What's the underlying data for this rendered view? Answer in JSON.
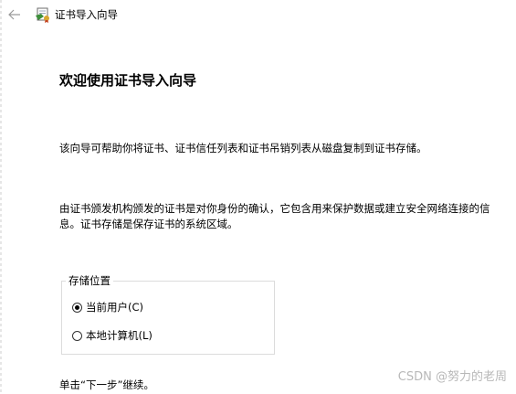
{
  "window": {
    "title": "证书导入向导"
  },
  "icons": {
    "back": "arrow-left-icon",
    "app": "certificate-icon"
  },
  "colors": {
    "background": "#ffffff",
    "text": "#000000",
    "group_border": "#dcdcdc",
    "watermark": "#b8b8b8"
  },
  "main": {
    "heading": "欢迎使用证书导入向导",
    "intro": "该向导可帮助你将证书、证书信任列表和证书吊销列表从磁盘复制到证书存储。",
    "description_lines": [
      "由证书颁发机构颁发的证书是对你身份的确认，它包含用来保护数据或建立安全网络连接的信",
      "息。证书存储是保存证书的系统区域。"
    ]
  },
  "store_location": {
    "legend": "存储位置",
    "options": [
      {
        "label": "当前用户(C)",
        "checked": true
      },
      {
        "label": "本地计算机(L)",
        "checked": false
      }
    ]
  },
  "footer": {
    "instruction": "单击“下一步”继续。"
  },
  "watermark": "CSDN @努力的老周"
}
